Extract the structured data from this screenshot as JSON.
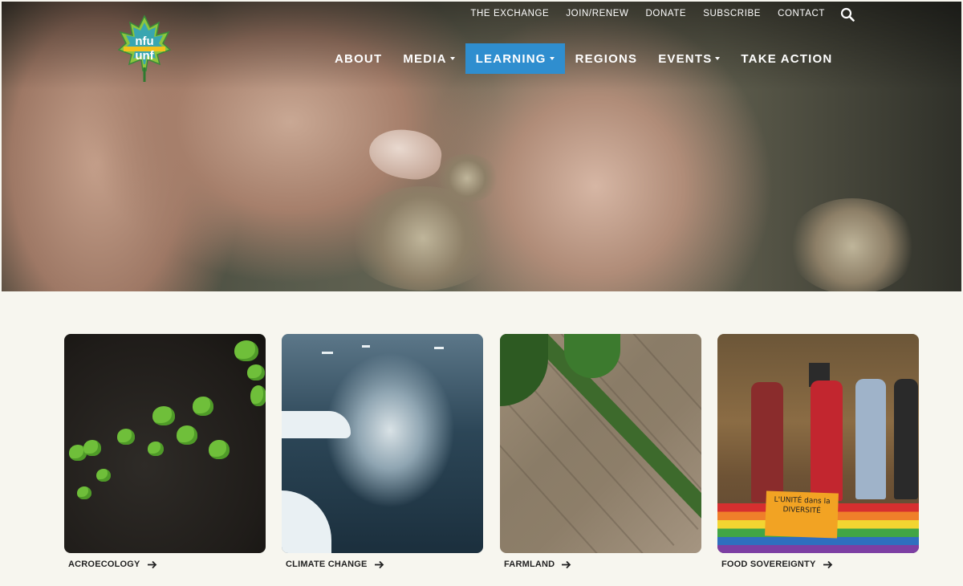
{
  "utility_nav": {
    "items": [
      "THE EXCHANGE",
      "JOIN/RENEW",
      "DONATE",
      "SUBSCRIBE",
      "CONTACT"
    ],
    "search_icon": "search-icon"
  },
  "logo": {
    "text_top": "nfu",
    "text_bottom": "unf",
    "icon": "maple-leaf-logo"
  },
  "main_nav": {
    "items": [
      {
        "label": "ABOUT",
        "dropdown": false,
        "active": false
      },
      {
        "label": "MEDIA",
        "dropdown": true,
        "active": false
      },
      {
        "label": "LEARNING",
        "dropdown": true,
        "active": true
      },
      {
        "label": "REGIONS",
        "dropdown": false,
        "active": false
      },
      {
        "label": "EVENTS",
        "dropdown": true,
        "active": false
      },
      {
        "label": "TAKE ACTION",
        "dropdown": false,
        "active": false
      }
    ],
    "active_color": "#2f8ecf"
  },
  "cards": [
    {
      "label": "ACROECOLOGY",
      "icon": "arrow-right-icon"
    },
    {
      "label": "CLIMATE CHANGE",
      "icon": "arrow-right-icon"
    },
    {
      "label": "FARMLAND",
      "icon": "arrow-right-icon"
    },
    {
      "label": "FOOD SOVEREIGNTY",
      "icon": "arrow-right-icon"
    }
  ],
  "food_card_sign": "L'UNITÉ dans la DIVERSITÉ"
}
